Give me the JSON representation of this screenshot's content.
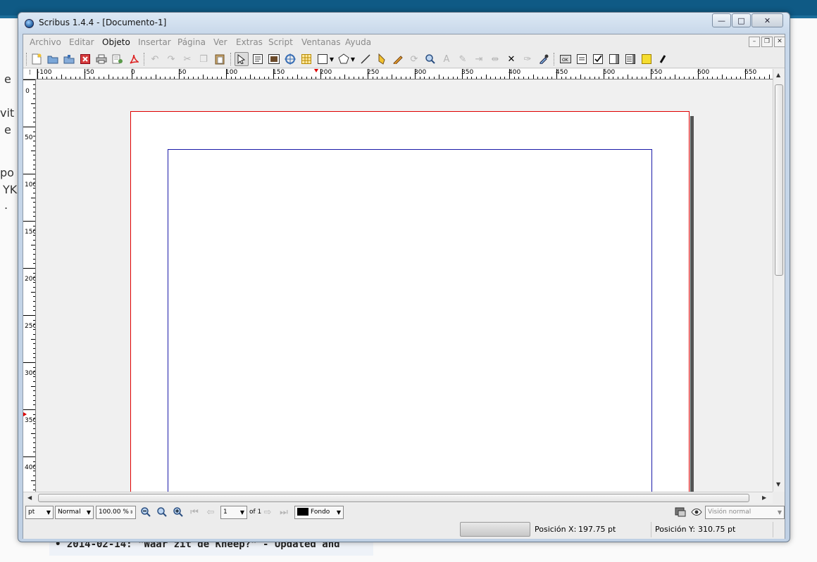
{
  "background": {
    "fragments": [
      "e",
      "vit",
      "e",
      "po",
      "YK",
      "."
    ],
    "bottom_text": "• 2014-02-14: \"Waar zit de Kneep?\" - Updated and"
  },
  "window": {
    "title": "Scribus 1.4.4 - [Documento-1]",
    "min_glyph": "—",
    "max_glyph": "□",
    "close_glyph": "✕"
  },
  "menu": {
    "items": [
      "Archivo",
      "Editar",
      "Objeto",
      "Insertar",
      "Página",
      "Ver",
      "Extras",
      "Script",
      "Ventanas",
      "Ayuda"
    ],
    "active_index": 2,
    "mdi_min": "–",
    "mdi_restore": "❐",
    "mdi_close": "✕"
  },
  "toolbar": {
    "icons": [
      "new-document-icon",
      "open-icon",
      "save-icon",
      "close-doc-icon",
      "print-icon",
      "preflight-icon",
      "export-pdf-icon",
      "undo-icon",
      "redo-icon",
      "cut-icon",
      "copy-icon",
      "paste-icon",
      "select-icon",
      "text-frame-icon",
      "image-frame-icon",
      "render-frame-icon",
      "table-icon",
      "shape-icon",
      "polygon-icon",
      "line-icon",
      "bezier-icon",
      "freehand-icon",
      "rotate-icon",
      "zoom-icon",
      "edit-contents-icon",
      "edit-text-icon",
      "link-frames-icon",
      "unlink-frames-icon",
      "measure-icon",
      "copy-properties-icon",
      "eyedropper-icon",
      "pdf-push-button-icon",
      "pdf-text-field-icon",
      "pdf-checkbox-icon",
      "pdf-combo-icon",
      "pdf-list-icon",
      "pdf-annotation-icon",
      "pdf-link-icon"
    ]
  },
  "rulers": {
    "corner_glyph": "⁝",
    "h_labels": [
      "-100",
      "-50",
      "0",
      "50",
      "100",
      "150",
      "200",
      "250",
      "300",
      "350",
      "400",
      "450",
      "500",
      "550",
      "600",
      "650"
    ],
    "v_labels": [
      "0",
      "50",
      "100",
      "150",
      "200",
      "250",
      "300",
      "350",
      "400"
    ]
  },
  "bottom": {
    "unit": "pt",
    "mode": "Normal",
    "zoom": "100.00 %",
    "page_current": "1",
    "page_of": "of 1",
    "layer": "Fondo",
    "view_mode": "Visión normal"
  },
  "status": {
    "pos_x_label": "Posición X:",
    "pos_x_value": "197.75 pt",
    "pos_y_label": "Posición Y:",
    "pos_y_value": "310.75 pt"
  },
  "colors": {
    "page_border": "#e00000",
    "margin_guide": "#1a1aa8",
    "layer_swatch": "#000000"
  }
}
